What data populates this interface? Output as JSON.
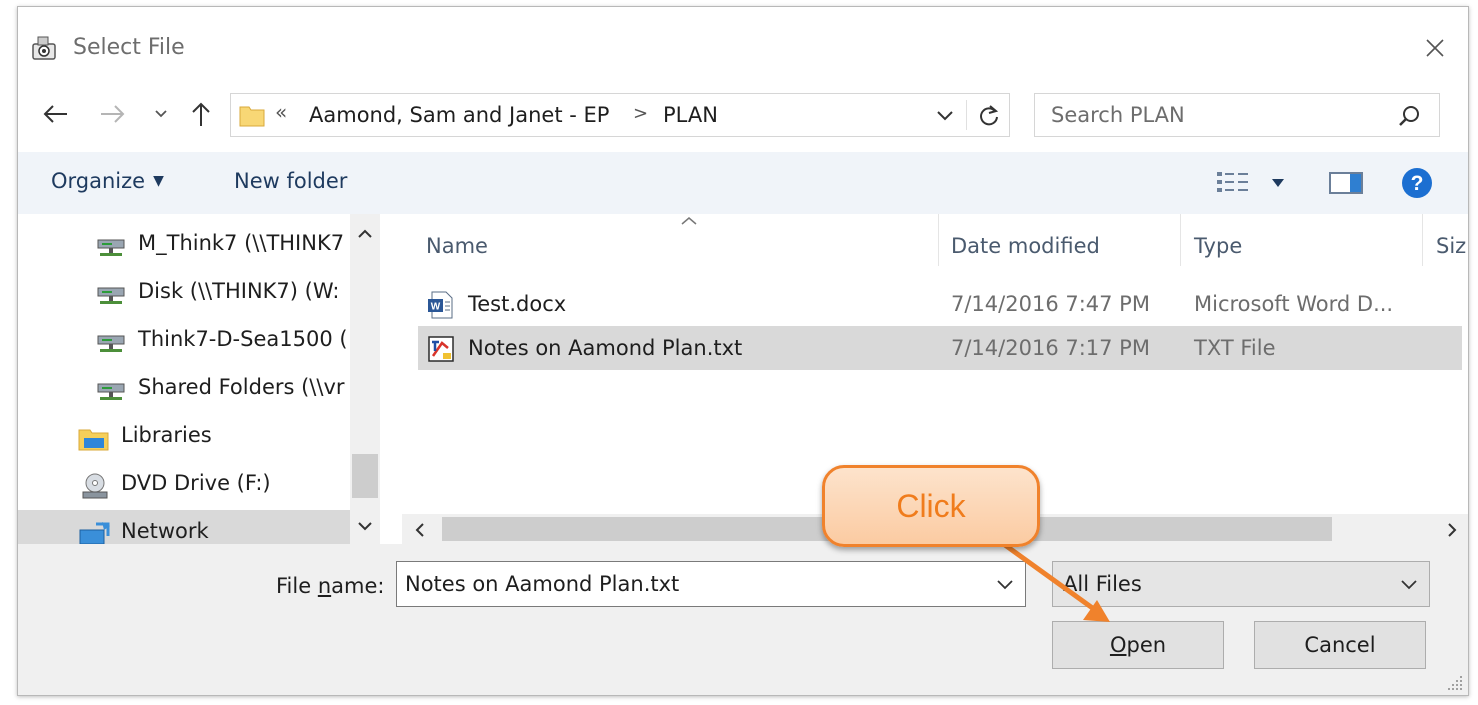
{
  "window": {
    "title": "Select File"
  },
  "navigation": {
    "address": {
      "overflow_chevron": "«",
      "crumbs": [
        "Aamond, Sam and Janet - EP",
        "PLAN"
      ],
      "separator": ">"
    },
    "search": {
      "placeholder": "Search PLAN"
    }
  },
  "toolbar": {
    "organize_label": "Organize",
    "new_folder_label": "New folder"
  },
  "sidebar": {
    "items": [
      {
        "label": "M_Think7 (\\\\THINK7",
        "icon": "network-drive-icon"
      },
      {
        "label": "Disk (\\\\THINK7) (W:",
        "icon": "network-drive-icon"
      },
      {
        "label": "Think7-D-Sea1500 (",
        "icon": "network-drive-icon"
      },
      {
        "label": "Shared Folders (\\\\vr",
        "icon": "network-drive-icon"
      },
      {
        "label": "Libraries",
        "icon": "libraries-icon"
      },
      {
        "label": "DVD Drive (F:)",
        "icon": "dvd-drive-icon"
      },
      {
        "label": "Network",
        "icon": "network-icon",
        "selected": true
      }
    ]
  },
  "file_list": {
    "columns": [
      "Name",
      "Date modified",
      "Type",
      "Siz"
    ],
    "rows": [
      {
        "name": "Test.docx",
        "date": "7/14/2016 7:47 PM",
        "type": "Microsoft Word D...",
        "icon": "word-document-icon",
        "selected": false
      },
      {
        "name": "Notes on Aamond Plan.txt",
        "date": "7/14/2016 7:17 PM",
        "type": "TXT File",
        "icon": "text-file-icon",
        "selected": true
      }
    ]
  },
  "footer": {
    "file_name_label_pre": "File ",
    "file_name_label_underlined": "n",
    "file_name_label_post": "ame:",
    "file_name_value": "Notes on Aamond Plan.txt",
    "file_type_value": "All Files",
    "open_underlined": "O",
    "open_rest": "pen",
    "cancel_label": "Cancel"
  },
  "callout": {
    "text": "Click",
    "colors": {
      "border": "#f0822c",
      "fill": "#fbcba2",
      "text": "#f07c1c"
    }
  }
}
